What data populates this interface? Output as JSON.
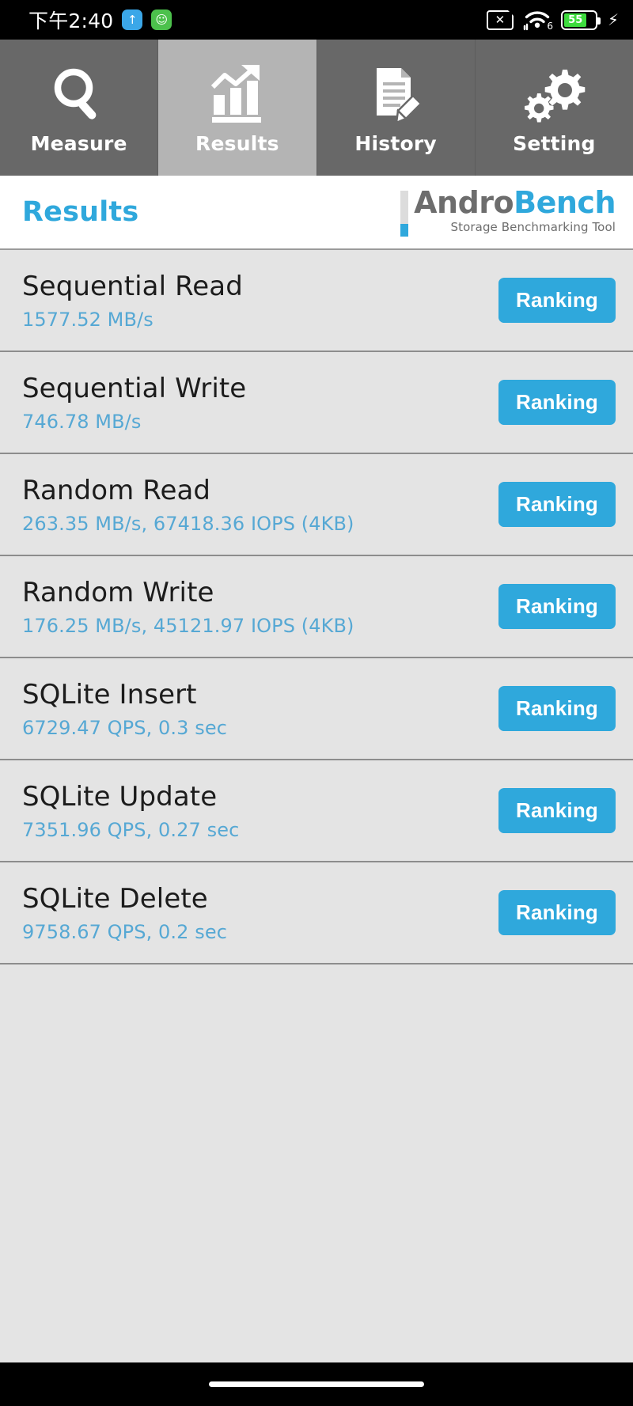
{
  "status_bar": {
    "clock": "下午2:40",
    "app_icons": [
      {
        "name": "upload-arrow-icon",
        "glyph": "↑",
        "color": "#3ba7e8"
      },
      {
        "name": "green-app-icon",
        "glyph": "☺",
        "color": "#4cc14c"
      }
    ],
    "sim_icon_glyph": "✕",
    "wifi_generation": "6",
    "battery_percent": "55",
    "battery_charging_glyph": "⚡",
    "battery_color": "#3ddc3d"
  },
  "tabs": [
    {
      "label": "Measure",
      "icon": "magnifier-icon",
      "active": false
    },
    {
      "label": "Results",
      "icon": "bar-chart-arrow-icon",
      "active": true
    },
    {
      "label": "History",
      "icon": "document-pencil-icon",
      "active": false
    },
    {
      "label": "Setting",
      "icon": "gears-icon",
      "active": false
    }
  ],
  "header": {
    "page_title": "Results",
    "logo_part1": "Andro",
    "logo_part2": "Bench",
    "logo_tagline": "Storage Benchmarking Tool",
    "accent_color": "#2fa8dc"
  },
  "results": {
    "ranking_button_label": "Ranking",
    "rows": [
      {
        "title": "Sequential Read",
        "value": "1577.52 MB/s"
      },
      {
        "title": "Sequential Write",
        "value": "746.78 MB/s"
      },
      {
        "title": "Random Read",
        "value": "263.35 MB/s, 67418.36 IOPS (4KB)"
      },
      {
        "title": "Random Write",
        "value": "176.25 MB/s, 45121.97 IOPS (4KB)"
      },
      {
        "title": "SQLite Insert",
        "value": "6729.47 QPS, 0.3 sec"
      },
      {
        "title": "SQLite Update",
        "value": "7351.96 QPS, 0.27 sec"
      },
      {
        "title": "SQLite Delete",
        "value": "9758.67 QPS, 0.2 sec"
      }
    ]
  }
}
